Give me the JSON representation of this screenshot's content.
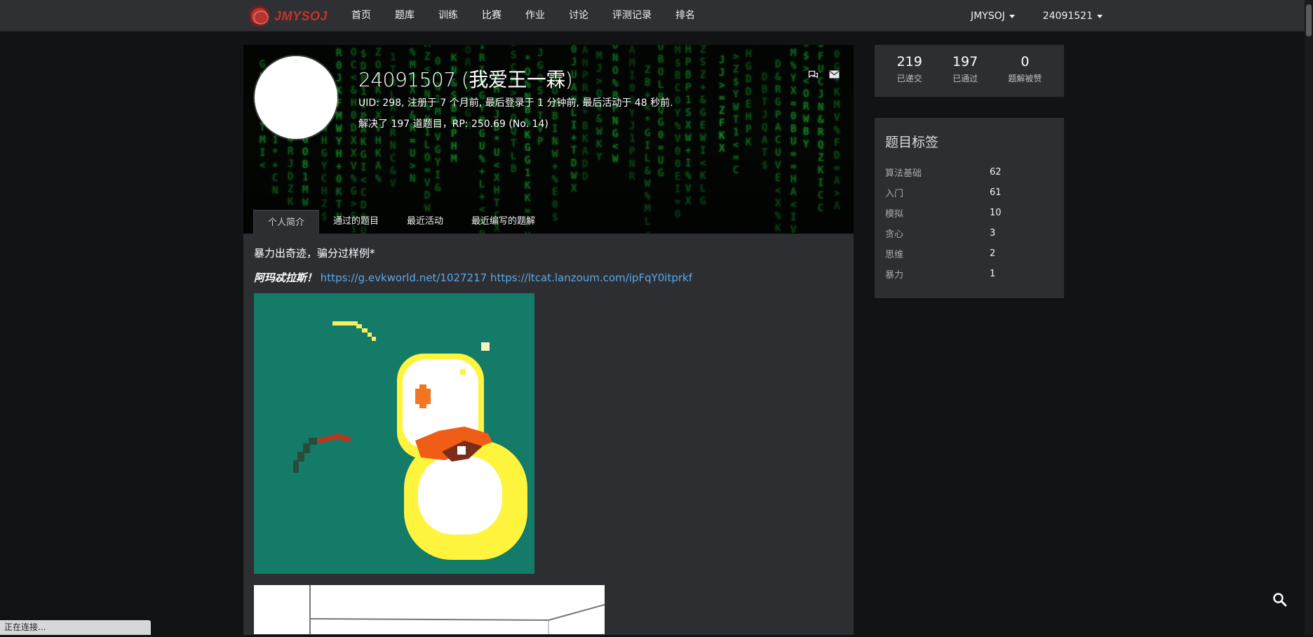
{
  "nav": {
    "logo_text": "JMYSOJ",
    "items": [
      "首页",
      "题库",
      "训练",
      "比赛",
      "作业",
      "讨论",
      "评测记录",
      "排名"
    ],
    "right": [
      {
        "label": "JMYSOJ"
      },
      {
        "label": "24091521"
      }
    ]
  },
  "profile": {
    "name": "24091507 (我爱王一霖)",
    "meta": "UID: 298, 注册于 7 个月前, 最后登录于 1 分钟前, 最后活动于 48 秒前.",
    "solved": "解决了 197 道题目，RP: 250.69 (No. 14)",
    "tabs": [
      "个人简介",
      "通过的题目",
      "最近活动",
      "最近编写的题解"
    ],
    "active_tab_index": 0
  },
  "bio": {
    "line1": "暴力出奇迹，骗分过样例*",
    "line2_bold": "阿玛忒拉斯！",
    "line2_links": "https://g.evkworld.net/1027217 https://ltcat.lanzoum.com/ipFqY0itprkf"
  },
  "stats": [
    {
      "value": "219",
      "label": "已递交"
    },
    {
      "value": "197",
      "label": "已通过"
    },
    {
      "value": "0",
      "label": "题解被赞"
    }
  ],
  "tags": {
    "title": "题目标签",
    "items": [
      {
        "name": "算法基础",
        "count": "62"
      },
      {
        "name": "入门",
        "count": "61"
      },
      {
        "name": "模拟",
        "count": "10"
      },
      {
        "name": "贪心",
        "count": "3"
      },
      {
        "name": "思维",
        "count": "2"
      },
      {
        "name": "暴力",
        "count": "1"
      }
    ]
  },
  "status_bar": "正在连接...",
  "colors": {
    "background": "#121314",
    "card": "#2d2e31",
    "link": "#59a9e8",
    "matrix_green": "#1ea535",
    "logo_red": "#c7322c"
  }
}
